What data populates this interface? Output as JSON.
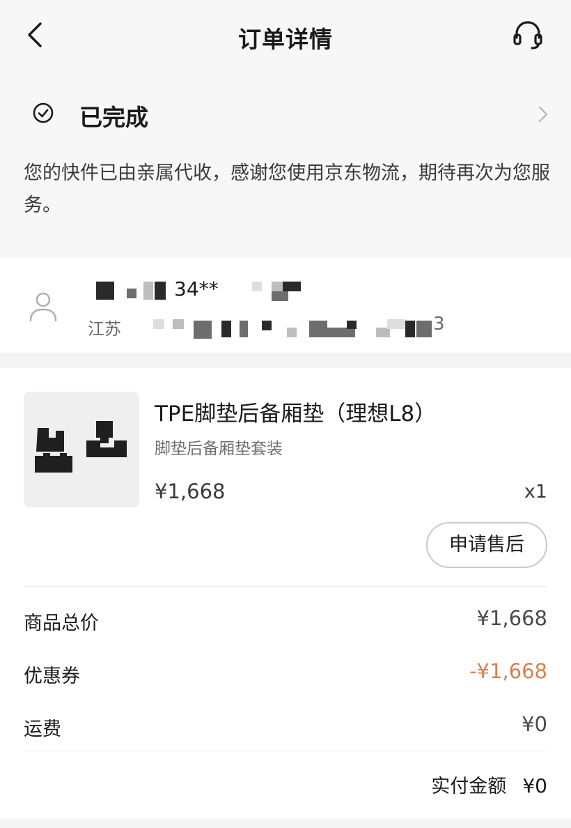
{
  "nav": {
    "title": "订单详情",
    "back_icon": "chevron-left-icon",
    "service_icon": "headset-icon"
  },
  "status": {
    "icon": "check-circle-icon",
    "label": "已完成",
    "description": "您的快件已由亲属代收，感谢您使用京东物流，期待再次为您服务。"
  },
  "address": {
    "icon": "person-icon",
    "name_visible": "34**",
    "line_visible": "江苏",
    "tail_visible": "3"
  },
  "product": {
    "name": "TPE脚垫后备厢垫（理想L8）",
    "spec": "脚垫后备厢垫套装",
    "price": "¥1,668",
    "quantity": "x1",
    "aftersale_label": "申请售后"
  },
  "fees": {
    "goods_total_label": "商品总价",
    "goods_total_value": "¥1,668",
    "coupon_label": "优惠券",
    "coupon_value": "-¥1,668",
    "shipping_label": "运费",
    "shipping_value": "¥0",
    "paid_label": "实付金额",
    "paid_value": "¥0"
  },
  "colors": {
    "discount": "#d9804e",
    "page_bg": "#f4f4f4",
    "card_bg": "#ffffff"
  }
}
